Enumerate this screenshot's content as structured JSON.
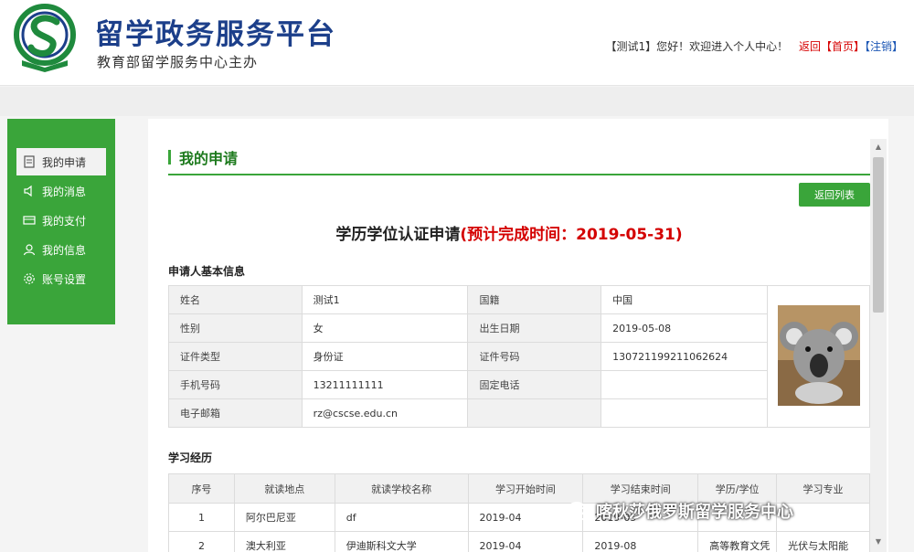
{
  "header": {
    "site_title": "留学政务服务平台",
    "site_subtitle": "教育部留学服务中心主办",
    "greeting_user": "【测试1】",
    "greeting_text": "您好！欢迎进入个人中心！",
    "link_back": "返回",
    "link_home": "【首页】",
    "link_logout": "【注销】"
  },
  "sidebar": {
    "items": [
      {
        "label": "我的申请",
        "icon": "document-icon"
      },
      {
        "label": "我的消息",
        "icon": "speaker-icon"
      },
      {
        "label": "我的支付",
        "icon": "card-icon"
      },
      {
        "label": "我的信息",
        "icon": "user-icon"
      },
      {
        "label": "账号设置",
        "icon": "gear-icon"
      }
    ]
  },
  "main": {
    "section_title": "我的申请",
    "back_list_label": "返回列表",
    "form_title": "学历学位认证申请",
    "deadline_text": "(预计完成时间：2019-05-31)",
    "paren_close": ")",
    "basic_info_title": "申请人基本信息",
    "basic_info": {
      "name_label": "姓名",
      "name_value": "测试1",
      "nationality_label": "国籍",
      "nationality_value": "中国",
      "gender_label": "性别",
      "gender_value": "女",
      "birth_label": "出生日期",
      "birth_value": "2019-05-08",
      "id_type_label": "证件类型",
      "id_type_value": "身份证",
      "id_no_label": "证件号码",
      "id_no_value": "130721199211062624",
      "mobile_label": "手机号码",
      "mobile_value": "13211111111",
      "phone_label": "固定电话",
      "phone_value": "",
      "email_label": "电子邮箱",
      "email_value": "rz@cscse.edu.cn"
    },
    "edu_title": "学习经历",
    "edu_headers": [
      "序号",
      "就读地点",
      "就读学校名称",
      "学习开始时间",
      "学习结束时间",
      "学历/学位",
      "学习专业"
    ],
    "edu_rows": [
      [
        "1",
        "阿尔巴尼亚",
        "df",
        "2019-04",
        "2019-05",
        "",
        ""
      ],
      [
        "2",
        "澳大利亚",
        "伊迪斯科文大学",
        "2019-04",
        "2019-08",
        "高等教育文凭",
        "光伏与太阳能"
      ]
    ]
  },
  "watermark": "喀秋莎俄罗斯留学服务中心",
  "colors": {
    "brand_green": "#3aa53a",
    "title_blue": "#1c3f8a",
    "deadline_red": "#d40000"
  }
}
